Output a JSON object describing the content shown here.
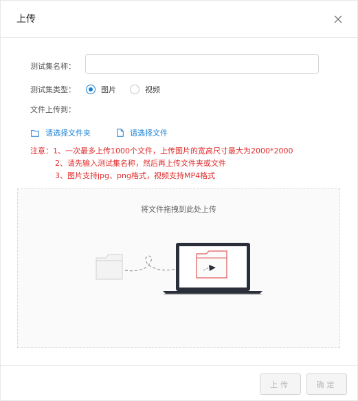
{
  "dialog": {
    "title": "上传"
  },
  "form": {
    "name_label": "测试集名称：",
    "name_value": "",
    "name_placeholder": "",
    "type_label": "测试集类型：",
    "type_options": [
      "图片",
      "视频"
    ],
    "type_selected": "图片",
    "upload_to_label": "文件上传到："
  },
  "actions": {
    "select_folder": "请选择文件夹",
    "select_file": "请选择文件"
  },
  "notes": {
    "line1": "注意：1、一次最多上传1000个文件，上传图片的宽高尺寸最大为2000*2000",
    "line2": "2、请先输入测试集名称，然后再上传文件夹或文件",
    "line3": "3、图片支持jpg、png格式，视频支持MP4格式"
  },
  "dropzone": {
    "text": "将文件拖拽到此处上传"
  },
  "footer": {
    "upload_button": "上传",
    "confirm_button": "确定"
  },
  "colors": {
    "accent": "#1a7fd4",
    "warning": "#e02b2b",
    "illustration_red": "#e05a5a"
  }
}
